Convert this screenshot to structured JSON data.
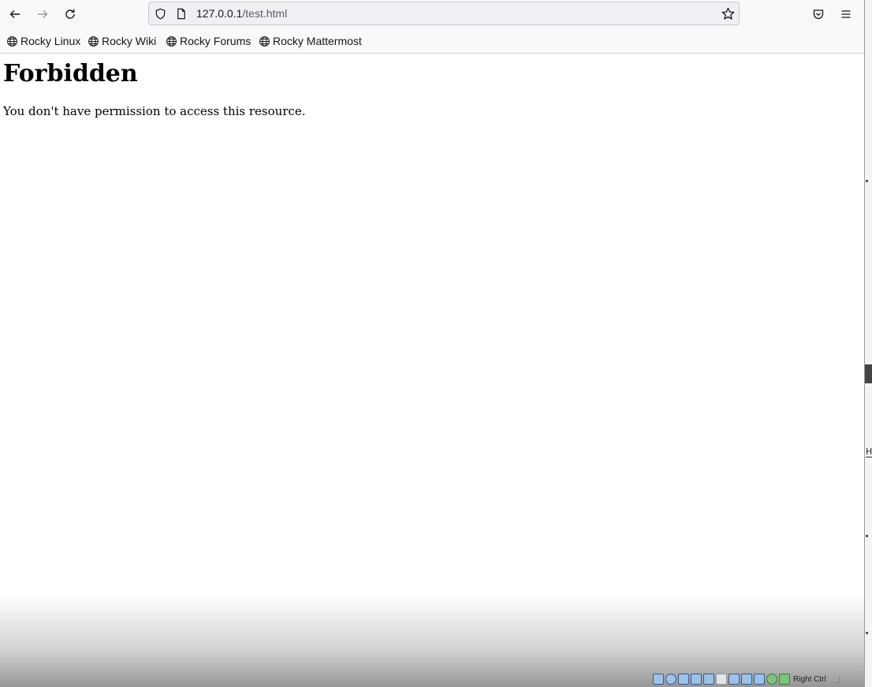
{
  "toolbar": {
    "url_host": "127.0.0.1",
    "url_path": "/test.html"
  },
  "bookmarks": [
    {
      "label": "Rocky Linux",
      "icon": "globe-icon"
    },
    {
      "label": "Rocky Wiki",
      "icon": "globe-icon"
    },
    {
      "label": "Rocky Forums",
      "icon": "globe-icon"
    },
    {
      "label": "Rocky Mattermost",
      "icon": "globe-icon"
    }
  ],
  "page": {
    "heading": "Forbidden",
    "message": "You don't have permission to access this resource."
  },
  "vm_status": {
    "host_key_label": "Right Ctrl",
    "edge_letter": "H"
  }
}
